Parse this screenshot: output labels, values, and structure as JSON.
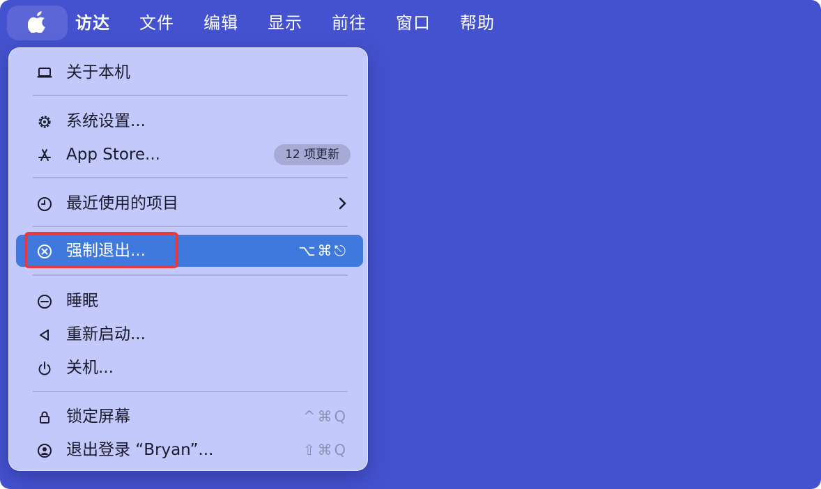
{
  "menubar": {
    "apple_icon": "apple-logo-icon",
    "items": [
      "访达",
      "文件",
      "编辑",
      "显示",
      "前往",
      "窗口",
      "帮助"
    ]
  },
  "menu": {
    "about": "关于本机",
    "system_settings": "系统设置...",
    "app_store": "App Store...",
    "app_store_badge": "12 项更新",
    "recent_items": "最近使用的项目",
    "force_quit": "强制退出...",
    "force_quit_shortcut": "⌥⌘⎋",
    "sleep": "睡眠",
    "restart": "重新启动...",
    "shutdown": "关机...",
    "lock_screen": "锁定屏幕",
    "lock_screen_shortcut": "^⌘Q",
    "logout": "退出登录 “Bryan”...",
    "logout_shortcut": "⇧⌘Q"
  },
  "colors": {
    "desktop": "#4552cf",
    "menu_background": "#c3cafb",
    "selection": "#3f79de",
    "annotation_box": "#e83a3e"
  }
}
